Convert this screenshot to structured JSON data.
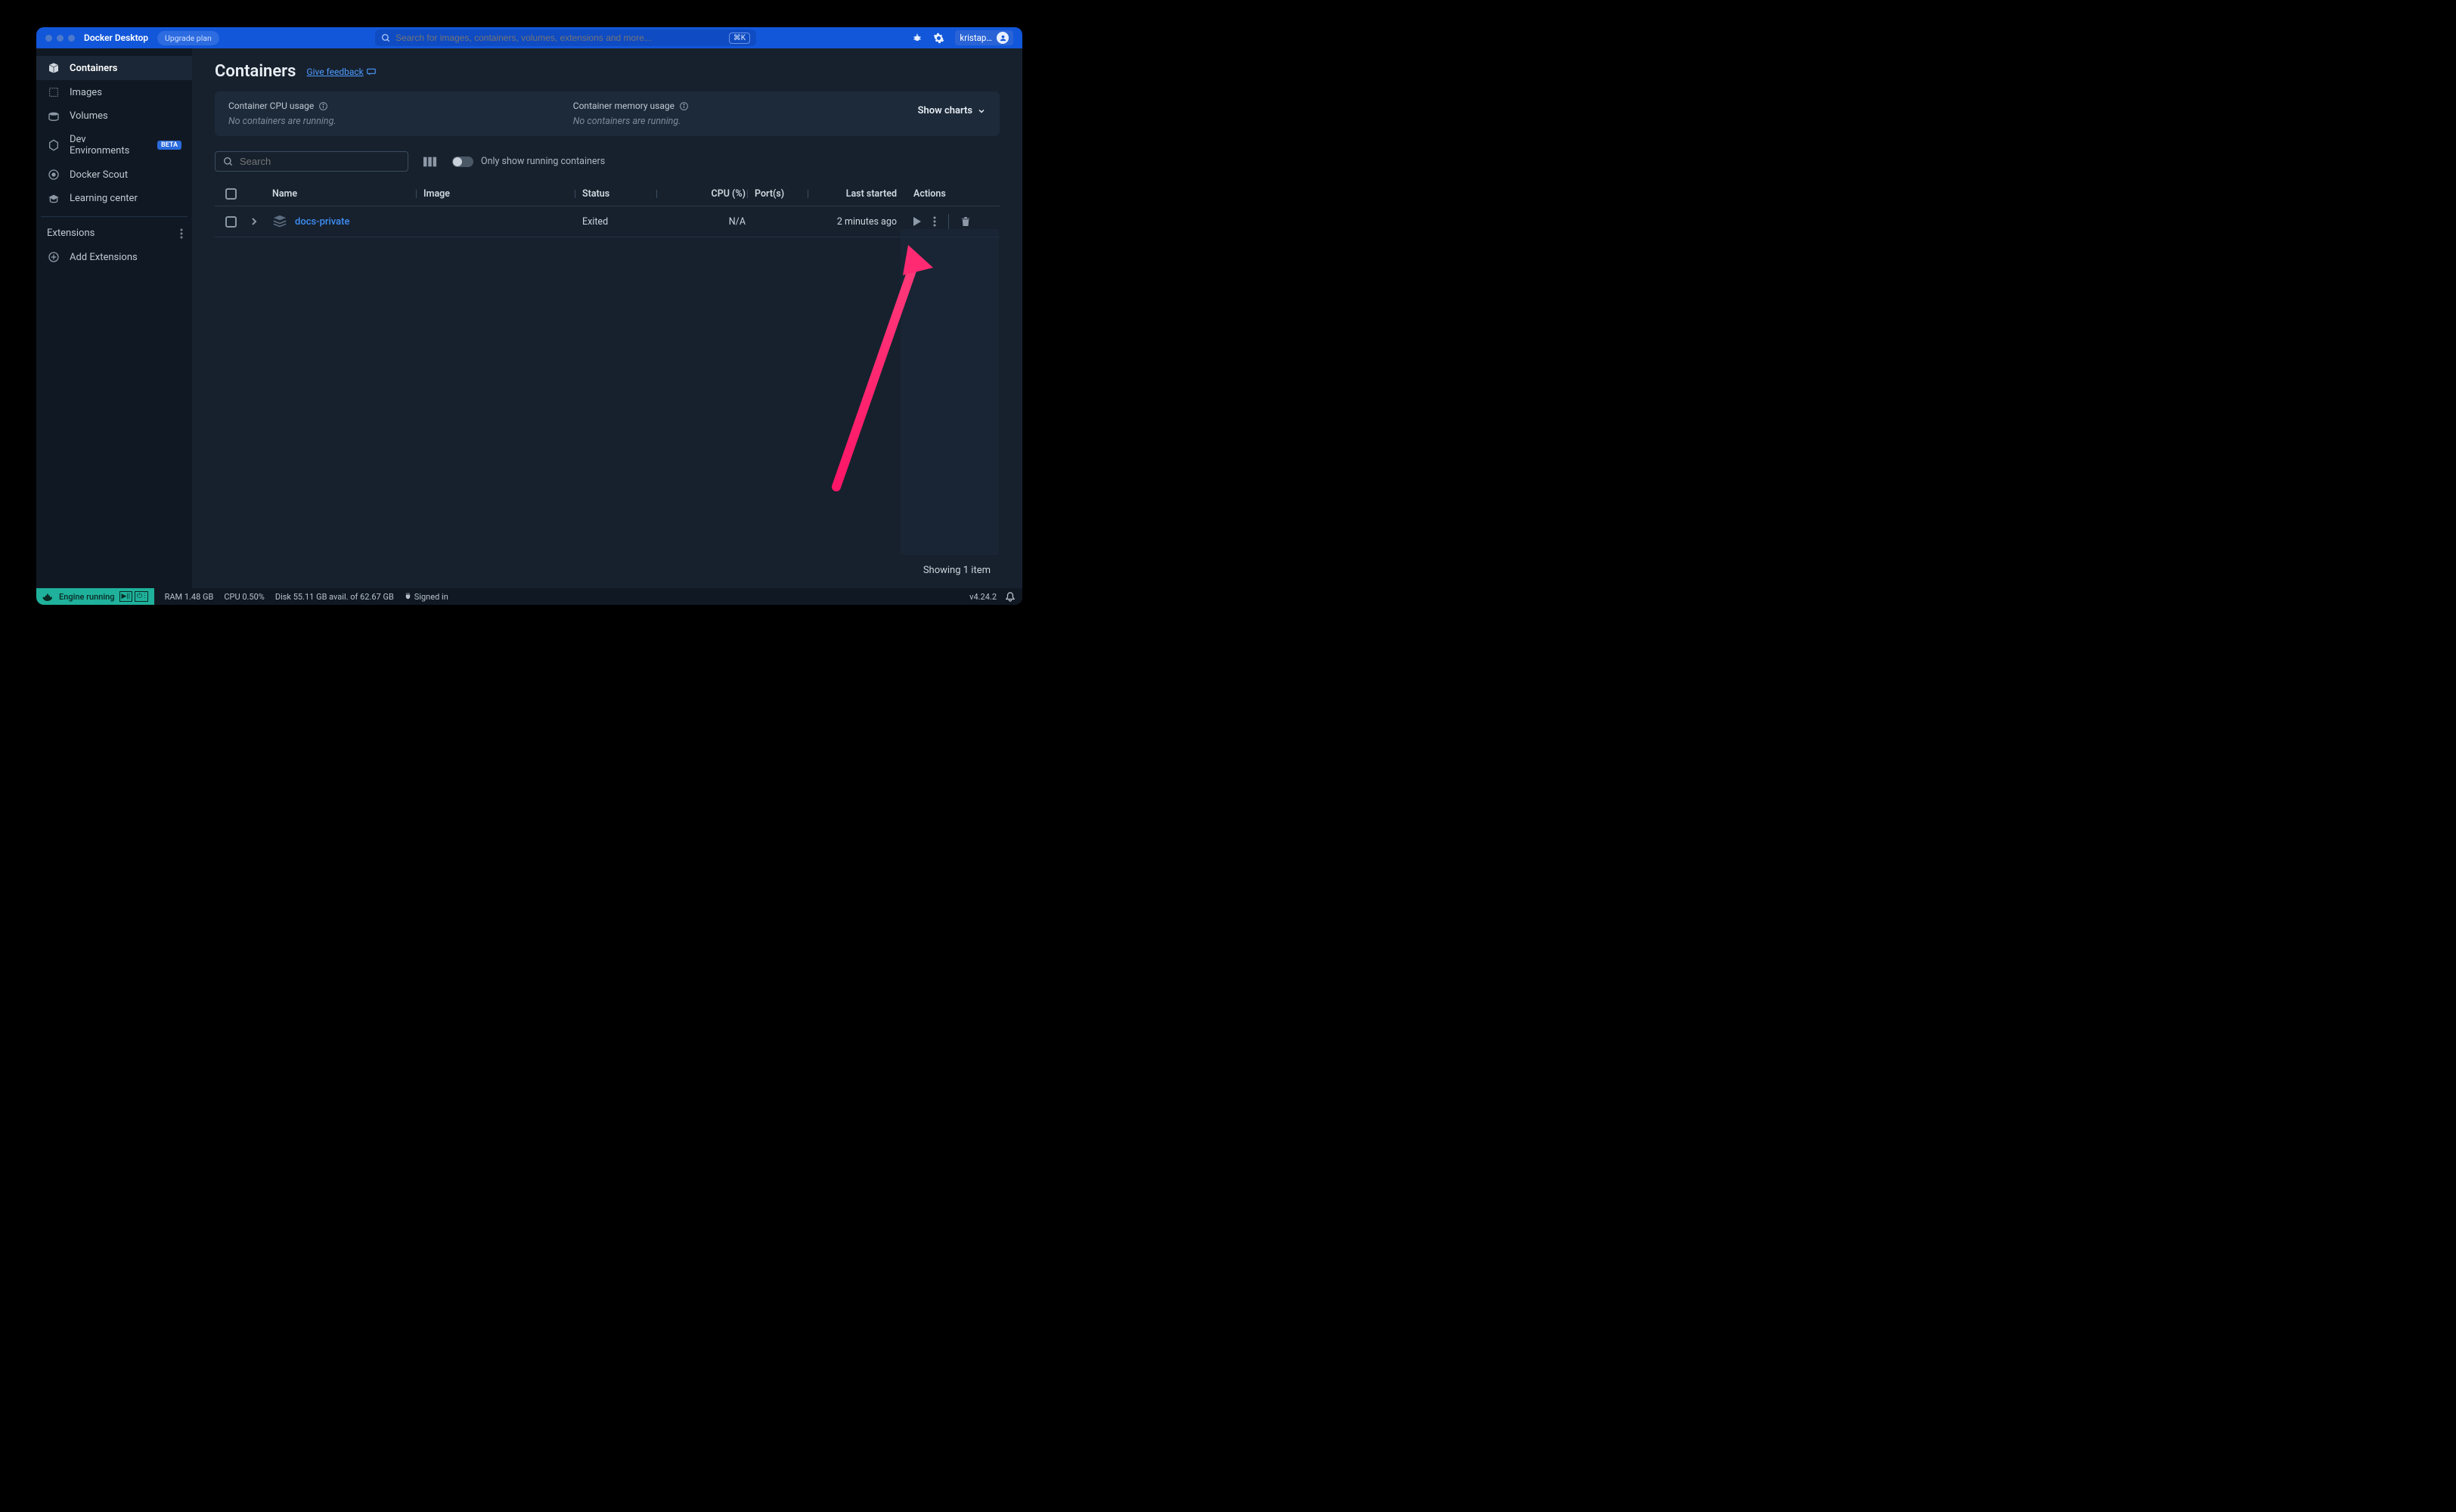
{
  "app": {
    "title": "Docker Desktop",
    "upgrade_label": "Upgrade plan",
    "search_placeholder": "Search for images, containers, volumes, extensions and more...",
    "shortcut": "⌘K",
    "username": "kristap…"
  },
  "sidebar": {
    "items": [
      {
        "label": "Containers"
      },
      {
        "label": "Images"
      },
      {
        "label": "Volumes"
      },
      {
        "label": "Dev Environments",
        "badge": "BETA"
      },
      {
        "label": "Docker Scout"
      },
      {
        "label": "Learning center"
      }
    ],
    "extensions_label": "Extensions",
    "add_extensions_label": "Add Extensions"
  },
  "main": {
    "title": "Containers",
    "feedback_label": "Give feedback",
    "stats": {
      "cpu_label": "Container CPU usage",
      "cpu_value": "No containers are running.",
      "mem_label": "Container memory usage",
      "mem_value": "No containers are running.",
      "show_charts_label": "Show charts"
    },
    "toolbar": {
      "search_placeholder": "Search",
      "toggle_label": "Only show running containers"
    },
    "columns": {
      "name": "Name",
      "image": "Image",
      "status": "Status",
      "cpu": "CPU (%)",
      "ports": "Port(s)",
      "last_started": "Last started",
      "actions": "Actions"
    },
    "rows": [
      {
        "name": "docs-private",
        "image": "",
        "status": "Exited",
        "cpu": "N/A",
        "ports": "",
        "last_started": "2 minutes ago"
      }
    ],
    "footer": "Showing 1 item"
  },
  "statusbar": {
    "engine_label": "Engine running",
    "ram": "RAM 1.48 GB",
    "cpu": "CPU 0.50%",
    "disk": "Disk 55.11 GB avail. of 62.67 GB",
    "signed_in": "Signed in",
    "version": "v4.24.2"
  }
}
